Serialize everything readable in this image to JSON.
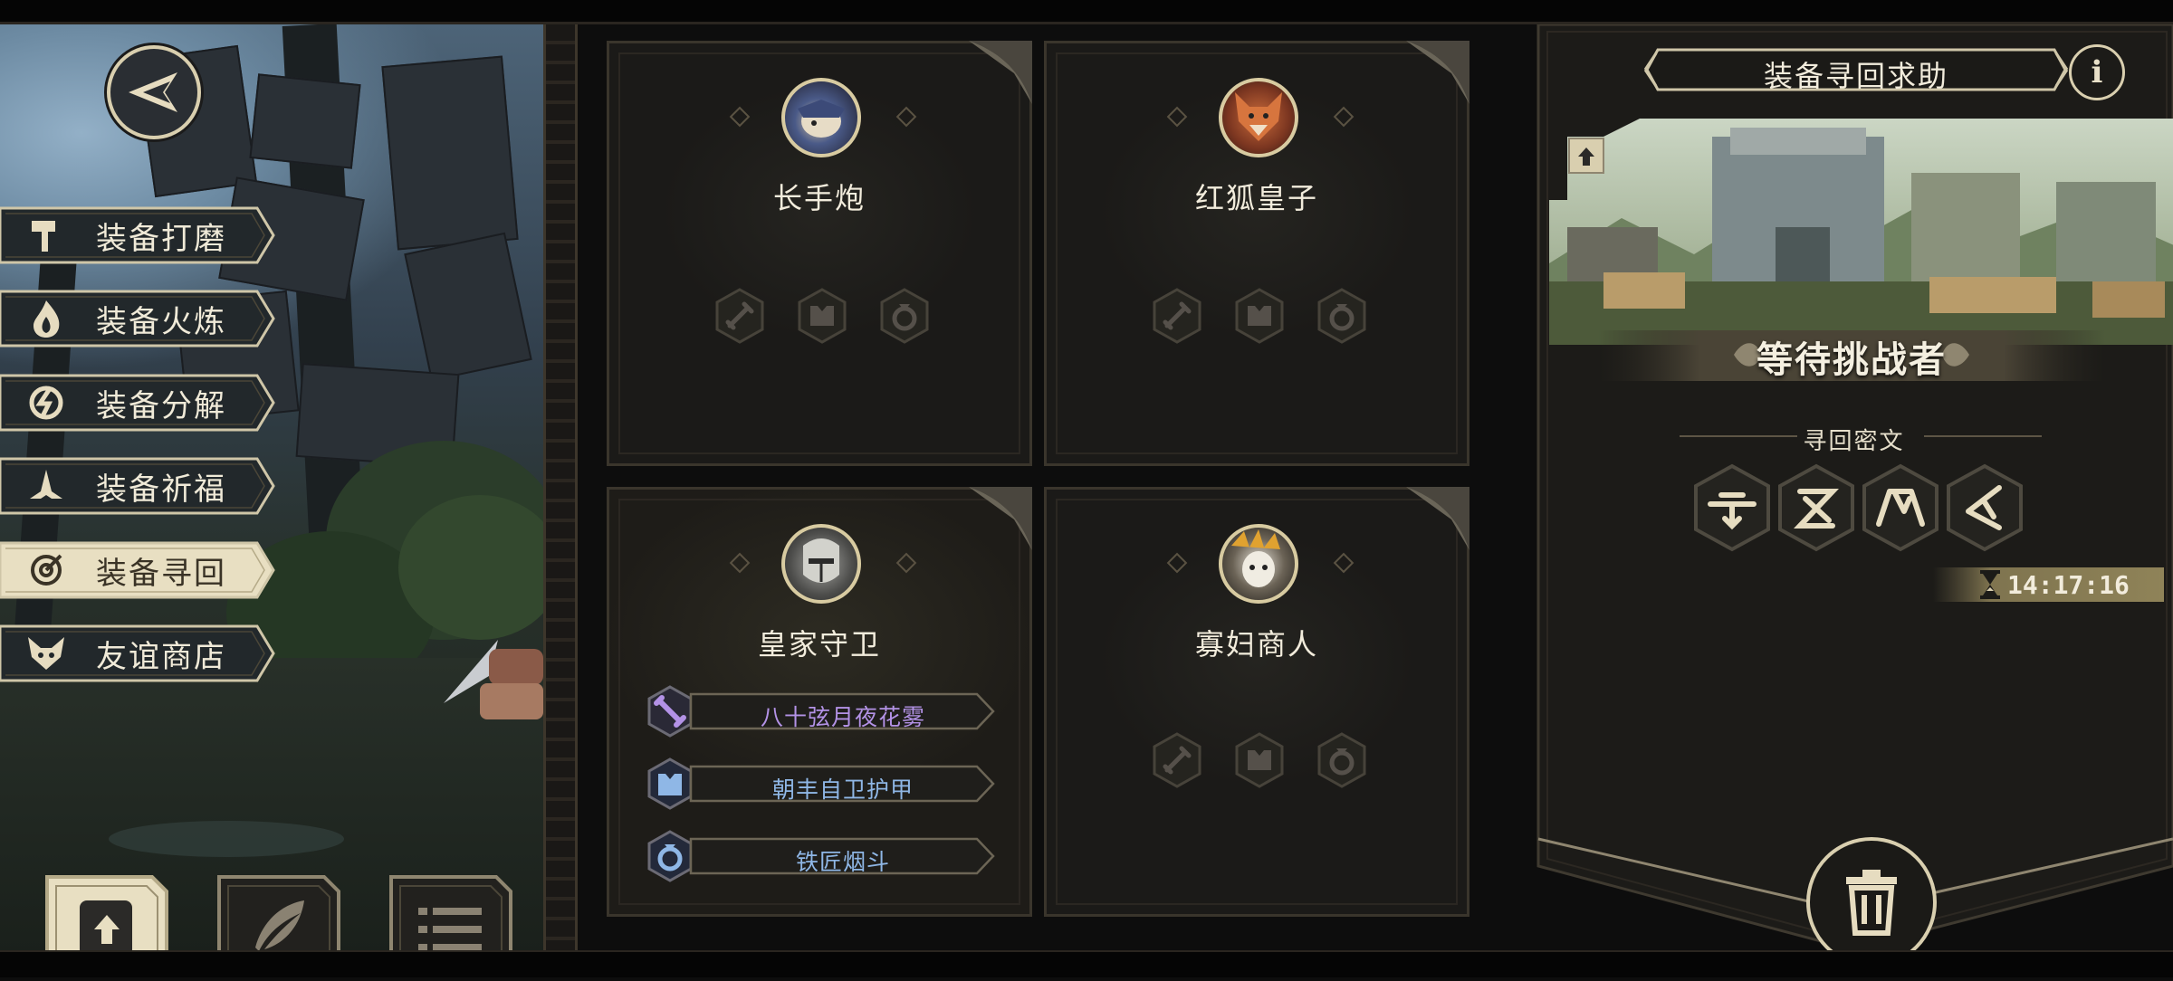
{
  "left_menu": {
    "items": [
      {
        "label": "装备打磨",
        "icon": "hammer-icon"
      },
      {
        "label": "装备火炼",
        "icon": "flame-icon"
      },
      {
        "label": "装备分解",
        "icon": "break-icon"
      },
      {
        "label": "装备祈福",
        "icon": "praying-hands-icon"
      },
      {
        "label": "装备寻回",
        "icon": "target-icon"
      },
      {
        "label": "友谊商店",
        "icon": "fox-head-icon"
      }
    ],
    "active_index": 4,
    "bottom_buttons": [
      "upload-icon",
      "feather-icon",
      "list-icon"
    ]
  },
  "cards": [
    {
      "name": "长手炮",
      "equipment": []
    },
    {
      "name": "红狐皇子",
      "equipment": []
    },
    {
      "name": "皇家守卫",
      "equipment": [
        {
          "label": "八十弦月夜花雾",
          "color": "#b392e6",
          "type": "sword"
        },
        {
          "label": "朝丰自卫护甲",
          "color": "#8fb7e6",
          "type": "armor"
        },
        {
          "label": "铁匠烟斗",
          "color": "#8fb7e6",
          "type": "ring"
        }
      ]
    },
    {
      "name": "寡妇商人",
      "equipment": []
    }
  ],
  "right_panel": {
    "title": "装备寻回求助",
    "info_label": "i",
    "status": "等待挑战者",
    "cipher_label": "寻回密文",
    "runes": [
      "rune-1-icon",
      "rune-2-icon",
      "rune-3-icon",
      "rune-4-icon"
    ],
    "timer": "14:17:16"
  },
  "colors": {
    "gold": "#d9cfaf",
    "panel": "#1b1a18",
    "epic": "#b392e6",
    "rare": "#8fb7e6"
  }
}
